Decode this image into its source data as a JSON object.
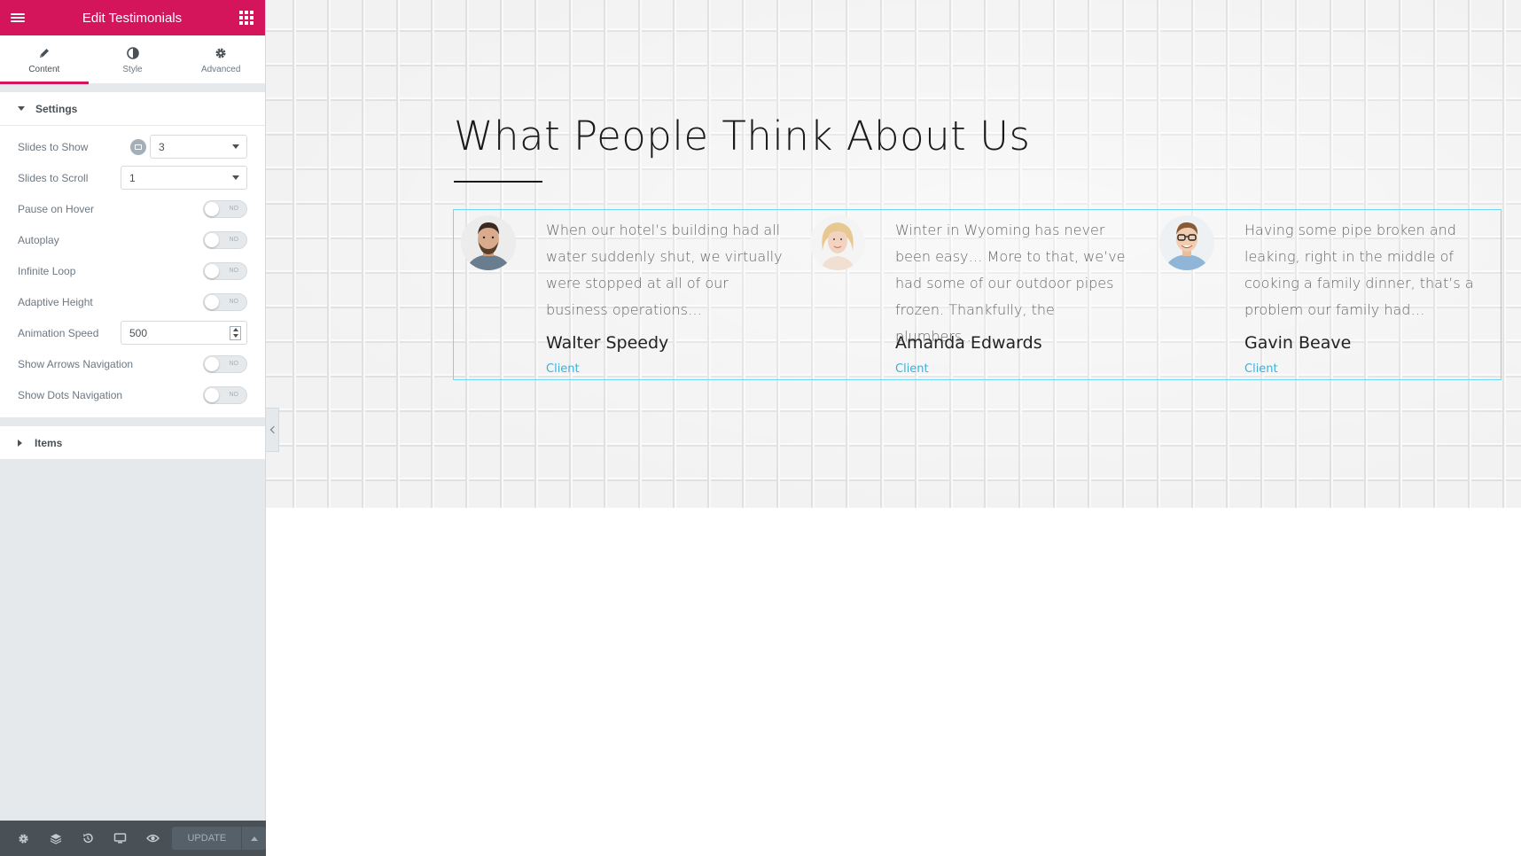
{
  "panel": {
    "title": "Edit Testimonials",
    "tabs": [
      {
        "label": "Content",
        "icon": "pencil-icon"
      },
      {
        "label": "Style",
        "icon": "contrast-icon"
      },
      {
        "label": "Advanced",
        "icon": "gear-icon"
      }
    ],
    "settings_section": "Settings",
    "controls": {
      "slides_to_show": {
        "label": "Slides to Show",
        "value": "3"
      },
      "slides_to_scroll": {
        "label": "Slides to Scroll",
        "value": "1"
      },
      "pause_on_hover": {
        "label": "Pause on Hover",
        "state": "NO"
      },
      "autoplay": {
        "label": "Autoplay",
        "state": "NO"
      },
      "infinite_loop": {
        "label": "Infinite Loop",
        "state": "NO"
      },
      "adaptive_height": {
        "label": "Adaptive Height",
        "state": "NO"
      },
      "animation_speed": {
        "label": "Animation Speed",
        "value": "500"
      },
      "show_arrows": {
        "label": "Show Arrows Navigation",
        "state": "NO"
      },
      "show_dots": {
        "label": "Show Dots Navigation",
        "state": "NO"
      }
    },
    "items_section": "Items",
    "footer": {
      "icons": [
        "settings-icon",
        "layers-icon",
        "history-icon",
        "responsive-icon",
        "preview-icon"
      ],
      "update_label": "UPDATE"
    }
  },
  "accent_color": "#d5155b",
  "preview": {
    "heading": "What People Think About Us",
    "testimonials": [
      {
        "quote": "When our hotel’s building had all water suddenly shut, we virtually were stopped at all of our business operations…",
        "name": "Walter Speedy",
        "role": "Client"
      },
      {
        "quote": "Winter in Wyoming has never been easy… More to that, we’ve had some of our outdoor pipes frozen. Thankfully, the plumbers…",
        "name": "Amanda Edwards",
        "role": "Client"
      },
      {
        "quote": "Having some pipe broken and leaking, right in the middle of cooking a family dinner, that’s a problem our family had…",
        "name": "Gavin Beave",
        "role": "Client"
      }
    ]
  }
}
